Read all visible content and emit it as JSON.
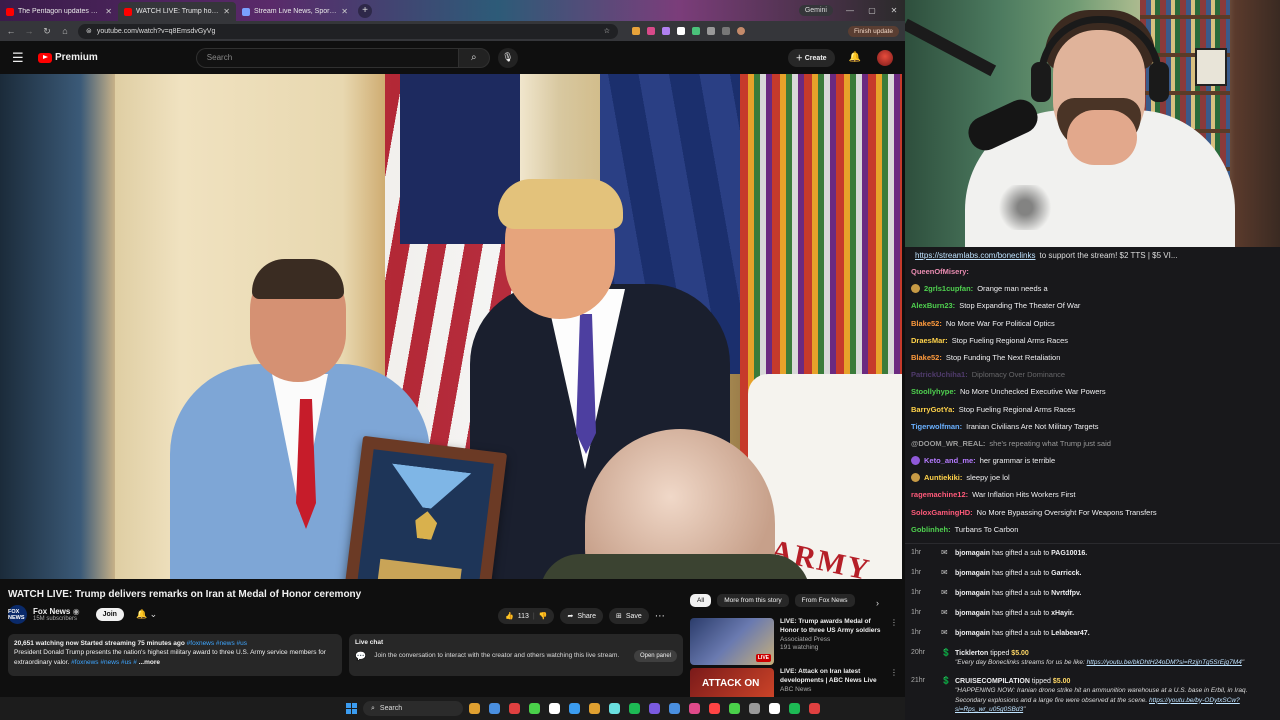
{
  "browser": {
    "tabs": [
      {
        "title": "The Pentagon updates on mili...",
        "color": "#ff0000",
        "active": false
      },
      {
        "title": "WATCH LIVE: Trump hosts M...",
        "color": "#ff0000",
        "active": true
      },
      {
        "title": "Stream Live News, Sports, ...",
        "color": "#7aa0ff",
        "active": false
      }
    ],
    "new_tab": "+",
    "gemini_label": "Gemini",
    "window_controls": [
      "—",
      "▢",
      "✕"
    ],
    "url": "youtube.com/watch?v=q8EmsdvGyVg",
    "finish_update": "Finish update"
  },
  "youtube": {
    "logo_text": "Premium",
    "search_placeholder": "Search",
    "create_label": "Create",
    "video": {
      "title": "WATCH LIVE: Trump delivers remarks on Iran at Medal of Honor ceremony",
      "channel": "Fox News",
      "subscribers": "15M subscribers",
      "channel_logo": "FOX NEWS",
      "join_label": "Join",
      "likes": "113",
      "share_label": "Share",
      "save_label": "Save",
      "overlay_text": "ARMY",
      "fox_bug": "FOX NEWS"
    },
    "description": {
      "stats": "20,651 watching now  Started streaming 75 minutes ago",
      "hashtags": " #foxnews #news #us",
      "text": "President Donald Trump presents the nation's highest military award to three U.S. Army service members for extraordinary valor.",
      "tags2": " #foxnews #news #us #",
      "more": " ...more"
    },
    "live_chat": {
      "title": "Live chat",
      "text": "Join the conversation to interact with the creator and others watching this live stream.",
      "button": "Open panel"
    },
    "chips": [
      "All",
      "More from this story",
      "From Fox News"
    ],
    "recommendations": [
      {
        "title": "LIVE: Trump awards Medal of Honor to three US Army soldiers",
        "channel": "Associated Press",
        "meta": "191 watching",
        "badge": "LIVE",
        "thumb_color": "#3a4a7a"
      },
      {
        "title": "LIVE: Attack on Iran latest developments | ABC News Live",
        "channel": "ABC News",
        "meta": "",
        "badge": "ATTACK ON",
        "thumb_color": "#7a1a1a"
      }
    ]
  },
  "stream_chat": {
    "top_link": "https://streamlabs.com/boneclinks",
    "top_text": " to support the stream! $2 TTS | $5 VI...",
    "messages": [
      {
        "user": "QueenOfMisery:",
        "text": "",
        "color": "#e88bb0",
        "badge": false,
        "faded": false
      },
      {
        "user": "2grls1cupfan:",
        "text": "Orange man needs a",
        "color": "#4fd14f",
        "badge": true,
        "faded": false
      },
      {
        "user": "AlexBurn23:",
        "text": "Stop Expanding The Theater Of War",
        "color": "#4fd14f",
        "badge": false,
        "faded": false
      },
      {
        "user": "Blake52:",
        "text": "No More War For Political Optics",
        "color": "#ff9a3c",
        "badge": false,
        "faded": false
      },
      {
        "user": "DraesMar:",
        "text": "Stop Fueling Regional Arms Races",
        "color": "#ffd24a",
        "badge": false,
        "faded": false
      },
      {
        "user": "Blake52:",
        "text": "Stop Funding The Next Retaliation",
        "color": "#ff9a3c",
        "badge": false,
        "faded": false
      },
      {
        "user": "PatrickUchiha1:",
        "text": "Diplomacy Over Dominance",
        "color": "#b57bff",
        "badge": false,
        "faded": true
      },
      {
        "user": "Stoollyhype:",
        "text": "No More Unchecked Executive War Powers",
        "color": "#4fd14f",
        "badge": false,
        "faded": false
      },
      {
        "user": "BarryGotYa:",
        "text": "Stop Fueling Regional Arms Races",
        "color": "#ffd24a",
        "badge": false,
        "faded": false
      },
      {
        "user": "Tigerwolfman:",
        "text": "Iranian Civilians Are Not Military Targets",
        "color": "#6ab0ff",
        "badge": false,
        "faded": false
      },
      {
        "user": "@DOOM_WR_REAL:",
        "text": "she's repeating what Trump just said",
        "color": "#999999",
        "badge": false,
        "faded": false,
        "reply": true
      },
      {
        "user": "Keto_and_me:",
        "text": "her grammar is terrible",
        "color": "#b57bff",
        "badge": true,
        "faded": false
      },
      {
        "user": "Auntiekiki:",
        "text": "sleepy joe lol",
        "color": "#ffd24a",
        "badge": true,
        "faded": false
      },
      {
        "user": "ragemachine12:",
        "text": "War Inflation Hits Workers First",
        "color": "#ff5a7a",
        "badge": false,
        "faded": false
      },
      {
        "user": "SoloxGamingHD:",
        "text": "No More Bypassing Oversight For Weapons Transfers",
        "color": "#ff5a7a",
        "badge": false,
        "faded": false
      },
      {
        "user": "Goblinheh:",
        "text": "Turbans To Carbon",
        "color": "#4fd14f",
        "badge": false,
        "faded": false
      }
    ],
    "events": [
      {
        "time": "1hr",
        "user": "bjomagain",
        "text": " has gifted a sub to ",
        "target": "PAG10016."
      },
      {
        "time": "1hr",
        "user": "bjomagain",
        "text": " has gifted a sub to ",
        "target": "Garricck."
      },
      {
        "time": "1hr",
        "user": "bjomagain",
        "text": " has gifted a sub to ",
        "target": "Nvrtdfpv."
      },
      {
        "time": "1hr",
        "user": "bjomagain",
        "text": " has gifted a sub to ",
        "target": "xHayir."
      },
      {
        "time": "1hr",
        "user": "bjomagain",
        "text": " has gifted a sub to ",
        "target": "Lelabear47."
      }
    ],
    "tips": [
      {
        "time": "20hr",
        "user": "Ticklerton",
        "text": " tipped ",
        "amount": "$5.00",
        "quote": "\"Every day Boneclinks streams for us be like: ",
        "link": "https://youtu.be/bkDhtH24oDM?si=RzjjnTg5SrEjg7M4",
        "quote_end": "\""
      },
      {
        "time": "21hr",
        "user": "CRUISECOMPILATION",
        "text": " tipped ",
        "amount": "$5.00",
        "quote": "\"HAPPENING NOW: Iranian drone strike hit an ammunition warehouse at a U.S. base in Erbil, in Iraq. Secondary explosions and a large fire were observed at the scene. ",
        "link": "https://youtu.be/by-ODytxSCw?si=Rps_wr_u05g0SBd3",
        "quote_end": "\""
      }
    ]
  },
  "taskbar": {
    "search_label": "Search",
    "icons": [
      "#e0a030",
      "#4a8fe0",
      "#e04040",
      "#4ad04a",
      "#ffffff",
      "#3b9cf0",
      "#e0a030",
      "#6ae0e0",
      "#1db954",
      "#7a5ae0",
      "#4a8fe0",
      "#e04a8a",
      "#ff4444",
      "#4ad04a",
      "#9a9a9a",
      "#ffffff",
      "#1db954",
      "#e04040"
    ]
  }
}
